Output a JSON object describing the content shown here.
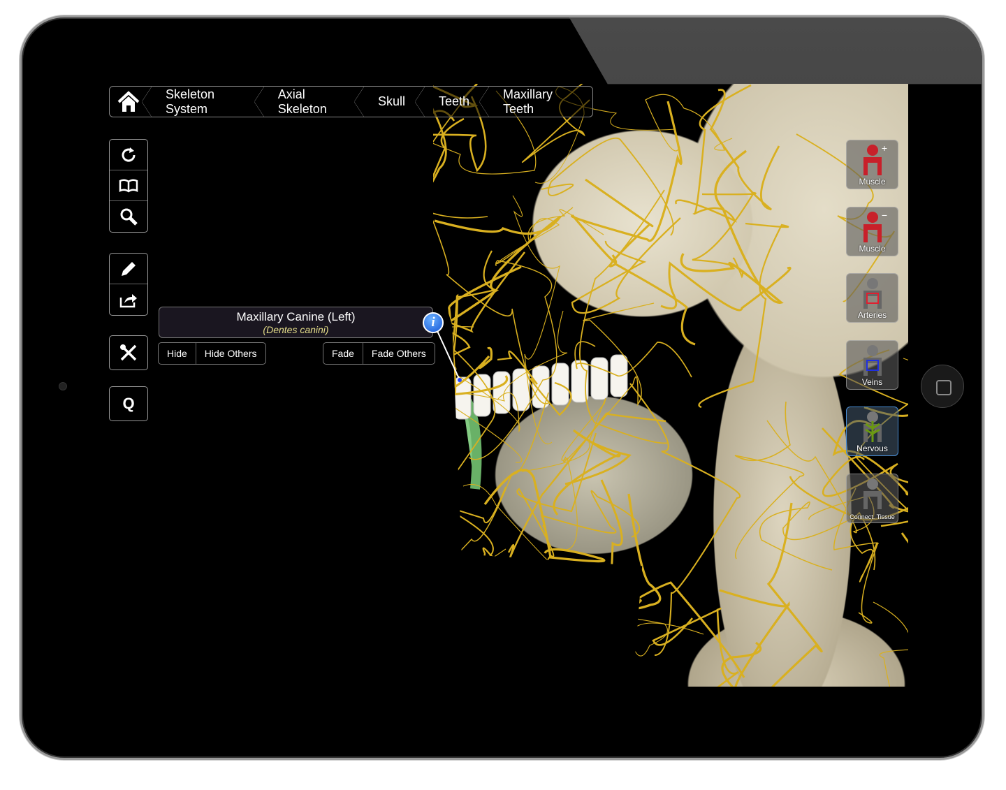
{
  "breadcrumb": {
    "items": [
      "Skeleton System",
      "Axial Skeleton",
      "Skull",
      "Teeth",
      "Maxillary Teeth"
    ],
    "home_icon": "home-icon"
  },
  "toolbar": {
    "groups": [
      [
        "reset-icon",
        "book-icon",
        "search-icon"
      ],
      [
        "pencil-icon",
        "share-icon"
      ],
      [
        "tools-icon"
      ],
      [
        "quiz-icon"
      ]
    ],
    "quiz_label": "Q"
  },
  "selection": {
    "title": "Maxillary Canine (Left)",
    "latin": "(Dentes canini)",
    "info": "i",
    "buttons_left": [
      "Hide",
      "Hide Others"
    ],
    "buttons_right": [
      "Fade",
      "Fade Others"
    ]
  },
  "systems": [
    {
      "label": "Muscle",
      "modifier": "+",
      "color": "#c8202a"
    },
    {
      "label": "Muscle",
      "modifier": "−",
      "color": "#c8202a"
    },
    {
      "label": "Arteries",
      "color": "#e02030"
    },
    {
      "label": "Veins",
      "color": "#2030e0"
    },
    {
      "label": "Nervous",
      "color": "#6a9a10",
      "active": true
    },
    {
      "label": "Connect. Tissue",
      "color": "#ffffff"
    }
  ],
  "colors": {
    "nerve": "#d9b020",
    "bone": "#ddd5bf",
    "highlight": "#9cf09a",
    "active_border": "#4a90d9"
  }
}
